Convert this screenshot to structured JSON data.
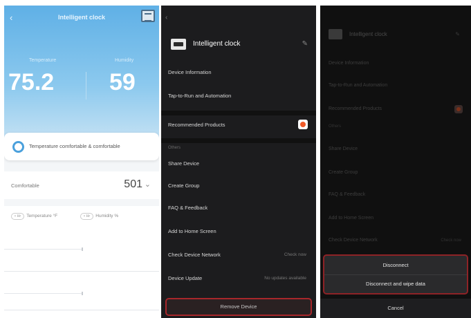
{
  "panel1": {
    "title": "Intelligent clock",
    "back_glyph": "‹",
    "temperature_label": "Temperature",
    "temperature_value": "75.2",
    "humidity_label": "Humidity",
    "humidity_value": "59",
    "status_text": "Temperature comfortable & comfortable",
    "comfort_label": "Comfortable",
    "comfort_value": "501",
    "comfort_chevron": "⌄",
    "legend": [
      {
        "chip": "• Hr",
        "label": "Temperature °F"
      },
      {
        "chip": "• Hr",
        "label": "Humidity %"
      }
    ]
  },
  "panel2": {
    "back_glyph": "‹",
    "device_name": "Intelligent clock",
    "edit_glyph": "✎",
    "items_top": [
      {
        "label": "Device Information"
      },
      {
        "label": "Tap-to-Run and Automation"
      }
    ],
    "recommended": {
      "label": "Recommended Products"
    },
    "section_others": "Others",
    "items_bottom": [
      {
        "label": "Share Device",
        "value": ""
      },
      {
        "label": "Create Group",
        "value": ""
      },
      {
        "label": "FAQ & Feedback",
        "value": ""
      },
      {
        "label": "Add to Home Screen",
        "value": ""
      },
      {
        "label": "Check Device Network",
        "value": "Check now"
      },
      {
        "label": "Device Update",
        "value": "No updates available"
      }
    ],
    "remove_button": "Remove Device"
  },
  "panel3": {
    "device_name": "Intelligent clock",
    "edit_glyph": "✎",
    "items_top": [
      {
        "label": "Device Information"
      },
      {
        "label": "Tap-to-Run and Automation"
      }
    ],
    "recommended": {
      "label": "Recommended Products"
    },
    "section_others": "Others",
    "items_bottom": [
      {
        "label": "Share Device",
        "value": ""
      },
      {
        "label": "Create Group",
        "value": ""
      },
      {
        "label": "FAQ & Feedback",
        "value": ""
      },
      {
        "label": "Add to Home Screen",
        "value": ""
      },
      {
        "label": "Check Device Network",
        "value": "Check now"
      }
    ],
    "sheet": {
      "disconnect": "Disconnect",
      "disconnect_wipe": "Disconnect and wipe data",
      "cancel": "Cancel"
    }
  },
  "colors": {
    "sky_top": "#5fb0e6",
    "dark_bg": "#1c1c1e",
    "highlight_red": "#a8272b",
    "accent_orange": "#f05a28"
  },
  "icons": [
    "back-arrow-icon",
    "menu-icon",
    "status-ring-icon",
    "chevron-down-icon",
    "device-icon",
    "edit-icon",
    "recommended-product-icon"
  ]
}
